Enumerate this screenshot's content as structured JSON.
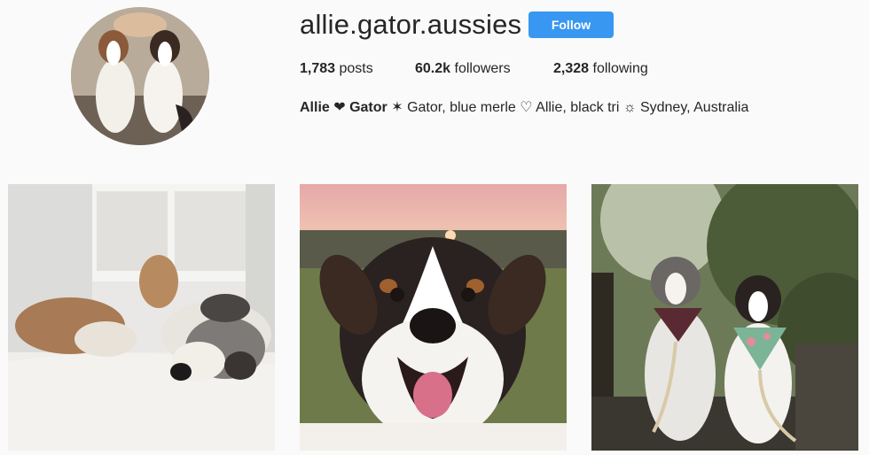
{
  "profile": {
    "username": "allie.gator.aussies",
    "follow_label": "Follow",
    "posts_count": "1,783",
    "posts_label": "posts",
    "followers_count": "60.2k",
    "followers_label": "followers",
    "following_count": "2,328",
    "following_label": "following",
    "bio_name": "Allie ❤ Gator",
    "bio_text": " ✶ Gator, blue merle ♡ Allie, black tri ☼ Sydney, Australia"
  },
  "colors": {
    "follow_button": "#3897f0",
    "background": "#fafafa"
  },
  "posts": [
    {
      "subject": "blue merle dog sleeping on bed with plush toy"
    },
    {
      "subject": "black tri dog smiling at sunset"
    },
    {
      "subject": "two dogs sitting with bandanas"
    }
  ]
}
